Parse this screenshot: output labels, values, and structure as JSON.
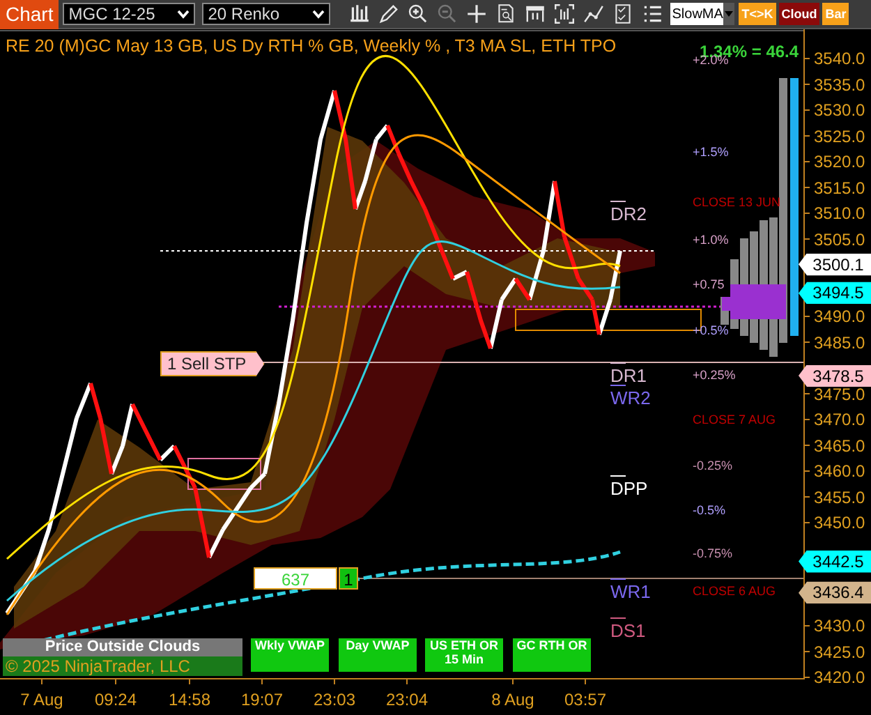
{
  "toolbar": {
    "tab": "Chart",
    "instrument": "MGC 12-25",
    "period": "20 Renko",
    "tools": [
      {
        "kind": "bars",
        "disabled": false
      },
      {
        "kind": "pencil",
        "disabled": false
      },
      {
        "kind": "zoom-in",
        "disabled": false
      },
      {
        "kind": "zoom-out",
        "disabled": true
      },
      {
        "kind": "crosshair",
        "disabled": false
      },
      {
        "kind": "doc-search",
        "disabled": false
      },
      {
        "kind": "tape",
        "disabled": false
      },
      {
        "kind": "frame-bars",
        "disabled": false
      },
      {
        "kind": "trend",
        "disabled": false
      },
      {
        "kind": "doc",
        "disabled": false
      },
      {
        "kind": "list",
        "disabled": false
      }
    ],
    "indicator_field": {
      "value": "SlowMA"
    },
    "buttons": [
      {
        "label": "T<>K",
        "color": "#f7a11a"
      },
      {
        "label": "Cloud",
        "color": "#8b0a0a"
      },
      {
        "label": "Bar",
        "color": "#f7a11a"
      }
    ]
  },
  "chart": {
    "title": "RE 20  (M)GC May 13 GB, US Dy RTH % GB, Weekly % , T3 MA SL, ETH TPO",
    "change": "1.34% = 46.4",
    "price_axis": [
      "3540.0",
      "3535.0",
      "3530.0",
      "3525.0",
      "3520.0",
      "3515.0",
      "3510.0",
      "3505.0",
      "3490.0",
      "3485.0",
      "3475.0",
      "3470.0",
      "3465.0",
      "3460.0",
      "3455.0",
      "3450.0",
      "3430.0",
      "3425.0",
      "3420.0"
    ],
    "time_axis": [
      "7 Aug",
      "09:24",
      "14:58",
      "19:07",
      "23:03",
      "23:04",
      "8 Aug",
      "03:57"
    ],
    "price_flags": [
      {
        "text": "3500.1",
        "color": "#ffffff"
      },
      {
        "text": "3494.5",
        "color": "#00ffff"
      },
      {
        "text": "3478.5",
        "color": "#ffc0cb"
      },
      {
        "text": "3442.5",
        "color": "#00ffff"
      },
      {
        "text": "3436.4",
        "color": "#d2b48c"
      }
    ],
    "level_labels": [
      {
        "text": "DR2",
        "color": "#d8b8d0"
      },
      {
        "text": "DR1",
        "color": "#d8b8d0"
      },
      {
        "text": "WR2",
        "color": "#7b68ee"
      },
      {
        "text": "DPP",
        "color": "#ffffff"
      },
      {
        "text": "WR1",
        "color": "#7b68ee"
      },
      {
        "text": "DS1",
        "color": "#d05a80"
      }
    ],
    "percent_labels": [
      {
        "text": "+2.0%",
        "color": "#d8a0c8"
      },
      {
        "text": "+1.5%",
        "color": "#b0a0ff"
      },
      {
        "text": "CLOSE 13 JUN",
        "color": "#c00000"
      },
      {
        "text": "+1.0%",
        "color": "#d8a0c8"
      },
      {
        "text": "+0.75",
        "color": "#d8a0c8"
      },
      {
        "text": "+0.5%",
        "color": "#b0a0ff"
      },
      {
        "text": "+0.25%",
        "color": "#d8a0c8"
      },
      {
        "text": "CLOSE 7 AUG",
        "color": "#c00000"
      },
      {
        "text": "-0.25%",
        "color": "#c890b0"
      },
      {
        "text": "-0.5%",
        "color": "#b0a0ff"
      },
      {
        "text": "-0.75%",
        "color": "#c890b0"
      },
      {
        "text": "CLOSE 6 AUG",
        "color": "#c00000"
      }
    ],
    "order": {
      "text": "1 Sell STP"
    },
    "position": {
      "quantity": "637",
      "count": "1"
    },
    "status_bar": {
      "text": "Price Outside Clouds"
    },
    "copyright": "© 2025 NinjaTrader, LLC",
    "indicator_buttons": [
      "Wkly VWAP",
      "Day VWAP",
      "US ETH OR 15 Min",
      "GC RTH OR"
    ]
  }
}
